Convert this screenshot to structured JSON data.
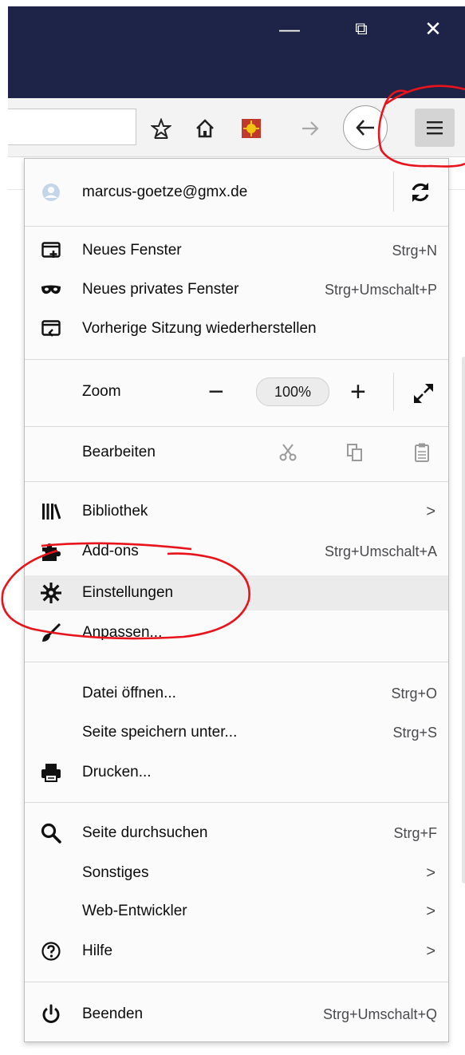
{
  "window_controls": {
    "minimize": "—",
    "restore": "⧉",
    "close": "✕"
  },
  "account": {
    "email": "marcus-goetze@gmx.de"
  },
  "menu": {
    "new_window": {
      "label": "Neues Fenster",
      "shortcut": "Strg+N"
    },
    "private_window": {
      "label": "Neues privates Fenster",
      "shortcut": "Strg+Umschalt+P"
    },
    "restore_session": {
      "label": "Vorherige Sitzung wiederherstellen"
    },
    "zoom": {
      "label": "Zoom",
      "minus": "−",
      "value": "100%",
      "plus": "+"
    },
    "edit": {
      "label": "Bearbeiten"
    },
    "library": {
      "label": "Bibliothek",
      "chevron": ">"
    },
    "addons": {
      "label": "Add-ons",
      "shortcut": "Strg+Umschalt+A"
    },
    "settings": {
      "label": "Einstellungen"
    },
    "customize": {
      "label": "Anpassen..."
    },
    "open_file": {
      "label": "Datei öffnen...",
      "shortcut": "Strg+O"
    },
    "save_page": {
      "label": "Seite speichern unter...",
      "shortcut": "Strg+S"
    },
    "print": {
      "label": "Drucken..."
    },
    "find": {
      "label": "Seite durchsuchen",
      "shortcut": "Strg+F"
    },
    "more": {
      "label": "Sonstiges",
      "chevron": ">"
    },
    "web_dev": {
      "label": "Web-Entwickler",
      "chevron": ">"
    },
    "help": {
      "label": "Hilfe",
      "chevron": ">"
    },
    "quit": {
      "label": "Beenden",
      "shortcut": "Strg+Umschalt+Q"
    }
  },
  "colors": {
    "titlebar": "#1e2448",
    "annotation_red": "#e8131b",
    "hover_row": "#ebebeb"
  }
}
